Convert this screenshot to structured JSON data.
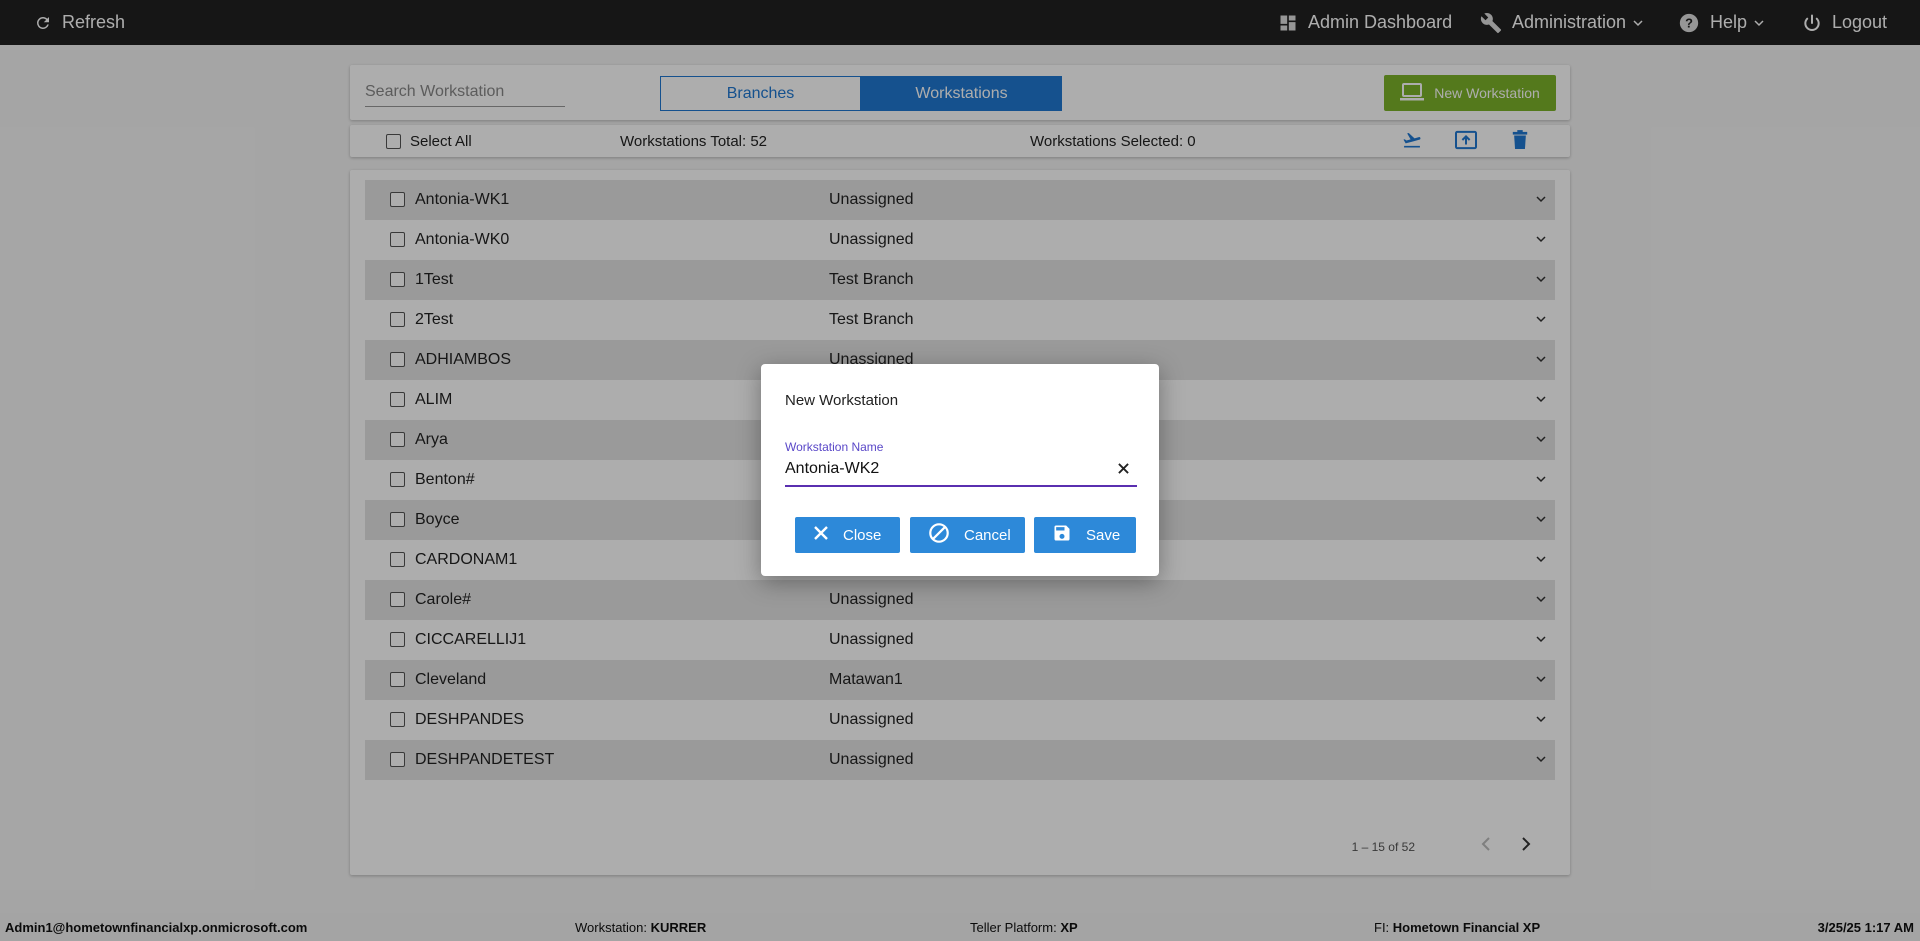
{
  "topbar": {
    "refresh_label": "Refresh",
    "admin_dashboard_label": "Admin Dashboard",
    "administration_label": "Administration",
    "help_label": "Help",
    "logout_label": "Logout"
  },
  "toolbar": {
    "search_placeholder": "Search Workstation",
    "tab_branches": "Branches",
    "tab_workstations": "Workstations",
    "active_tab": "Workstations",
    "new_workstation_label": "New Workstation"
  },
  "subbar": {
    "select_all_label": "Select All",
    "total_text": "Workstations Total: 52",
    "selected_text": "Workstations Selected: 0"
  },
  "workstations": [
    {
      "name": "Antonia-WK1",
      "branch": "Unassigned"
    },
    {
      "name": "Antonia-WK0",
      "branch": "Unassigned"
    },
    {
      "name": "1Test",
      "branch": "Test Branch"
    },
    {
      "name": "2Test",
      "branch": "Test Branch"
    },
    {
      "name": "ADHIAMBOS",
      "branch": "Unassigned"
    },
    {
      "name": "ALIM",
      "branch": ""
    },
    {
      "name": "Arya",
      "branch": ""
    },
    {
      "name": "Benton#",
      "branch": ""
    },
    {
      "name": "Boyce",
      "branch": ""
    },
    {
      "name": "CARDONAM1",
      "branch": ""
    },
    {
      "name": "Carole#",
      "branch": "Unassigned"
    },
    {
      "name": "CICCARELLIJ1",
      "branch": "Unassigned"
    },
    {
      "name": "Cleveland",
      "branch": "Matawan1"
    },
    {
      "name": "DESHPANDES",
      "branch": "Unassigned"
    },
    {
      "name": "DESHPANDETEST",
      "branch": "Unassigned"
    }
  ],
  "pagination": {
    "range_text": "1 – 15 of 52"
  },
  "dialog": {
    "title": "New Workstation",
    "field_label": "Workstation Name",
    "field_value": "Antonia-WK2",
    "close_label": "Close",
    "cancel_label": "Cancel",
    "save_label": "Save"
  },
  "footer": {
    "user": "Admin1@hometownfinancialxp.onmicrosoft.com",
    "workstation_prefix": "Workstation: ",
    "workstation_value": "KURRER",
    "platform_prefix": "Teller Platform: ",
    "platform_value": "XP",
    "fi_prefix": "FI: ",
    "fi_value": "Hometown Financial XP",
    "datetime": "3/25/25 1:17 AM"
  },
  "colors": {
    "topbar_bg": "#212121",
    "primary_blue": "#1f78d1",
    "new_button_green": "#7cb32a",
    "field_focus_purple": "#5a2fb0"
  }
}
